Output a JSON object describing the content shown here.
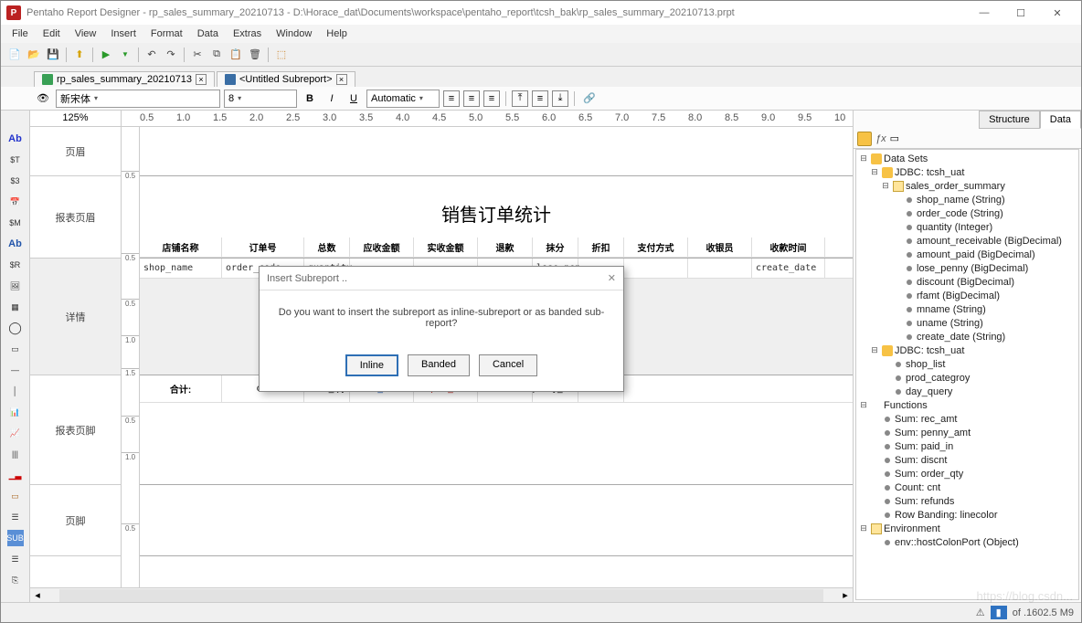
{
  "window": {
    "app_name": "Pentaho Report Designer",
    "doc": "rp_sales_summary_20210713",
    "path": "D:\\Horace_dat\\Documents\\workspace\\pentaho_report\\tcsh_bak\\rp_sales_summary_20210713.prpt"
  },
  "menus": [
    "File",
    "Edit",
    "View",
    "Insert",
    "Format",
    "Data",
    "Extras",
    "Window",
    "Help"
  ],
  "tabs": [
    {
      "label": "rp_sales_summary_20210713"
    },
    {
      "label": "<Untitled Subreport>"
    }
  ],
  "format": {
    "font_family": "新宋体",
    "font_size": "8",
    "color_mode": "Automatic",
    "zoom": "125%"
  },
  "ruler_ticks": [
    "0.5",
    "1.0",
    "1.5",
    "2.0",
    "2.5",
    "3.0",
    "3.5",
    "4.0",
    "4.5",
    "5.0",
    "5.5",
    "6.0",
    "6.5",
    "7.0",
    "7.5",
    "8.0",
    "8.5",
    "9.0",
    "9.5",
    "10"
  ],
  "band_names": {
    "page_header": "页眉",
    "report_header": "报表页眉",
    "details": "详情",
    "report_footer": "报表页脚",
    "page_footer": "页脚"
  },
  "report": {
    "title": "销售订单统计",
    "columns": [
      "店铺名称",
      "订单号",
      "总数",
      "应收金额",
      "实收金额",
      "退款",
      "抹分",
      "折扣",
      "支付方式",
      "收银员",
      "收款时间"
    ],
    "fields": [
      "shop_name",
      "order_code",
      "quantity",
      "",
      "",
      "",
      "lose_pen",
      "",
      "",
      "",
      "create_date"
    ],
    "footer_label": "合计:",
    "footer_cells": [
      "cnt",
      "order_qty",
      "rec_amt",
      "paid_in",
      "refunds",
      "penny_amt",
      "discnt"
    ]
  },
  "right": {
    "tabs": [
      "Structure",
      "Data"
    ],
    "active": "Data",
    "root": "Data Sets",
    "jdbc1": "JDBC: tcsh_uat",
    "query1": "sales_order_summary",
    "cols": [
      "shop_name (String)",
      "order_code (String)",
      "quantity (Integer)",
      "amount_receivable (BigDecimal)",
      "amount_paid (BigDecimal)",
      "lose_penny (BigDecimal)",
      "discount (BigDecimal)",
      "rfamt (BigDecimal)",
      "mname (String)",
      "uname (String)",
      "create_date (String)"
    ],
    "jdbc2": "JDBC: tcsh_uat",
    "jdbc2_items": [
      "shop_list",
      "prod_categroy",
      "day_query"
    ],
    "functions_label": "Functions",
    "functions": [
      "Sum: rec_amt",
      "Sum: penny_amt",
      "Sum: paid_in",
      "Sum: discnt",
      "Sum: order_qty",
      "Count: cnt",
      "Sum: refunds",
      "Row Banding: linecolor"
    ],
    "env_label": "Environment",
    "env_item": "env::hostColonPort (Object)"
  },
  "dialog": {
    "title": "Insert Subreport ..",
    "message": "Do you want to insert the subreport as inline-subreport or as banded sub-report?",
    "btn_inline": "Inline",
    "btn_banded": "Banded",
    "btn_cancel": "Cancel"
  },
  "status": "of .1602.5 M9"
}
